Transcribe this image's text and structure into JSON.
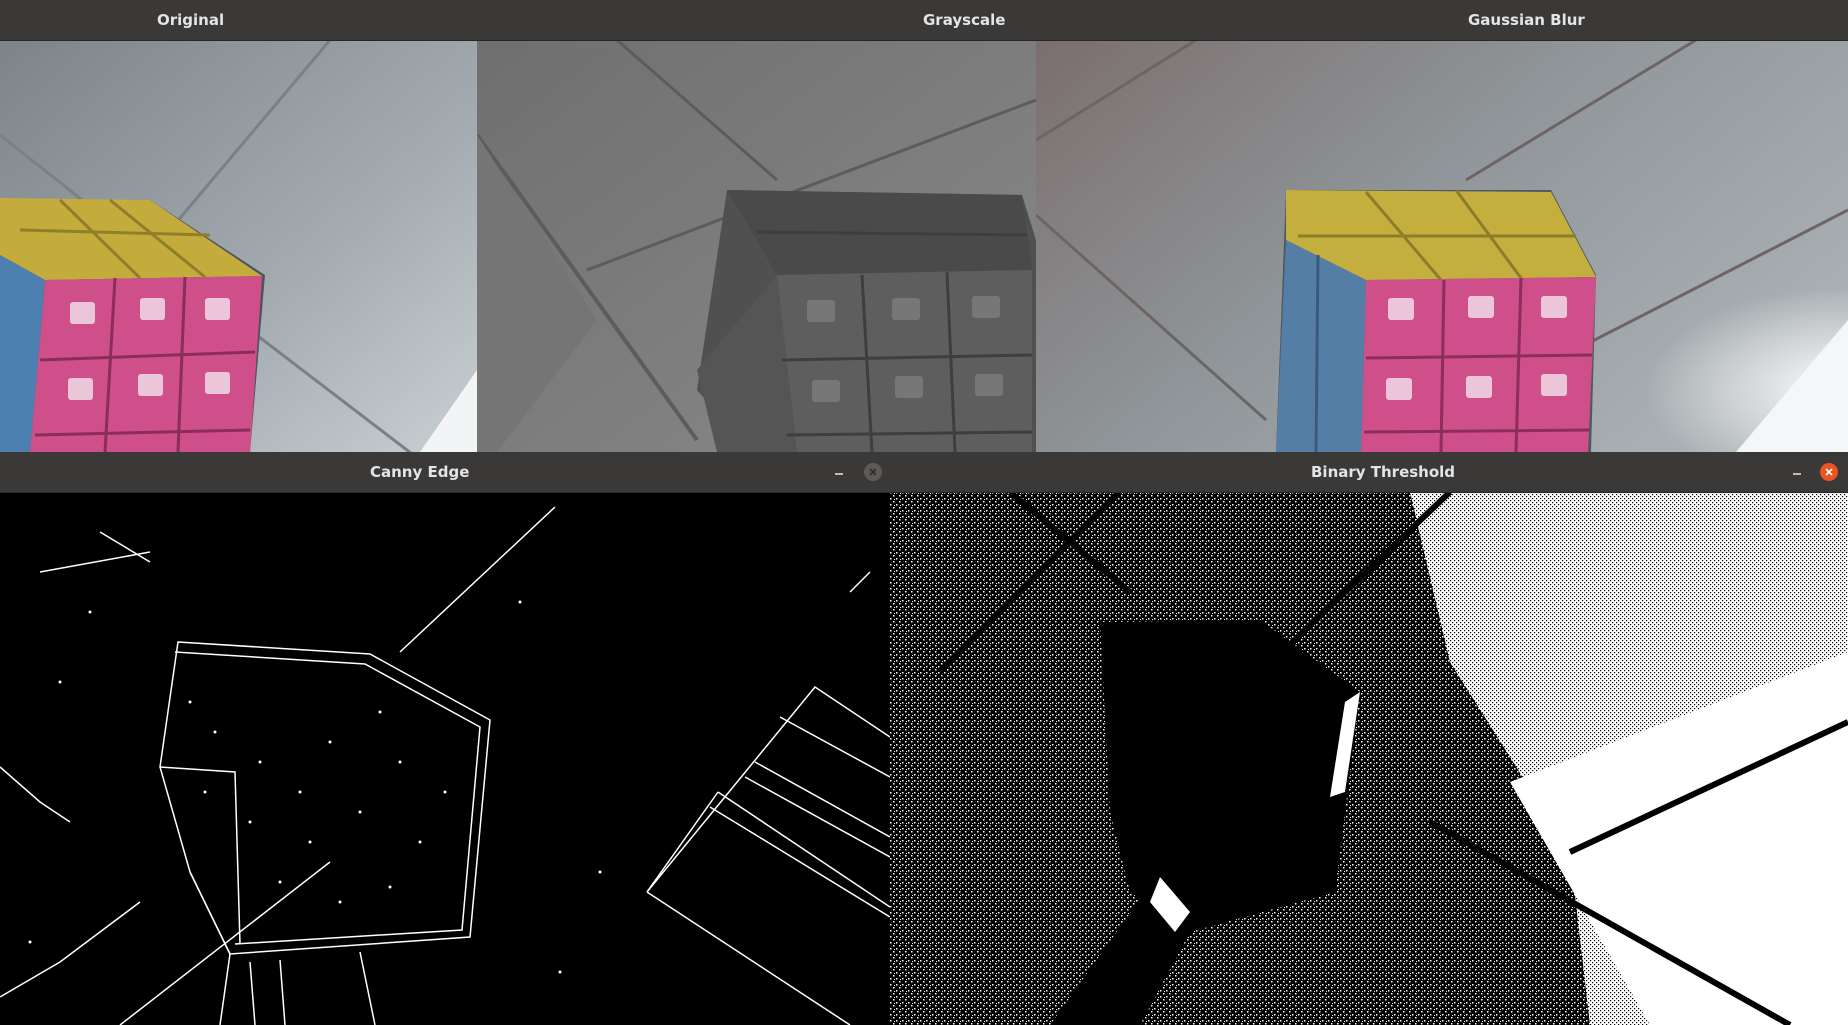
{
  "windows": {
    "original": {
      "title": "Original"
    },
    "grayscale": {
      "title": "Grayscale"
    },
    "gaussian": {
      "title": "Gaussian Blur"
    },
    "canny": {
      "title": "Canny Edge"
    },
    "binary": {
      "title": "Binary Threshold"
    }
  },
  "icons": {
    "minimize": "minimize-icon",
    "close": "close-icon"
  },
  "colors": {
    "titlebar": "#3a3938",
    "title_text": "#e4e4e4",
    "close_active": "#e95420",
    "close_inactive": "#5c5b58",
    "cube_yellow": "#c9b23e",
    "cube_pink": "#d4528e",
    "cube_blue": "#5b88b5"
  }
}
